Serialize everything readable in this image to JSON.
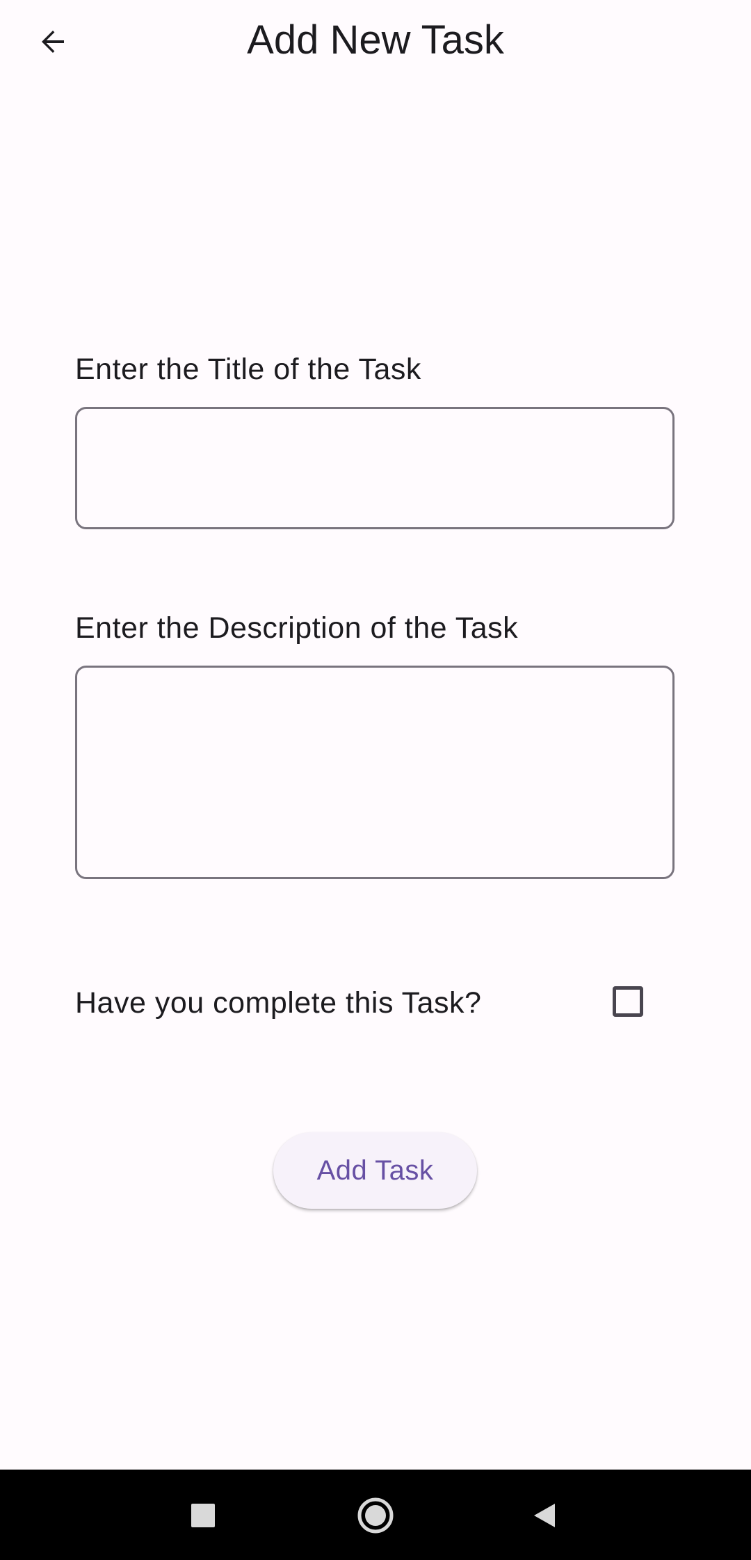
{
  "header": {
    "title": "Add New Task",
    "back_icon": "arrow-back-icon"
  },
  "form": {
    "title_label": "Enter the Title of the Task",
    "title_value": "",
    "description_label": "Enter the Description of the Task",
    "description_value": "",
    "complete_label": "Have you complete this Task?",
    "complete_checked": false,
    "submit_label": "Add Task"
  },
  "system_nav": {
    "recents_icon": "square-icon",
    "home_icon": "circle-icon",
    "back_icon": "triangle-back-icon"
  },
  "colors": {
    "background": "#fffbfe",
    "accent": "#6750a4",
    "button_surface": "#f7f2fa",
    "outline": "#79747e",
    "nav_bar": "#000000"
  }
}
